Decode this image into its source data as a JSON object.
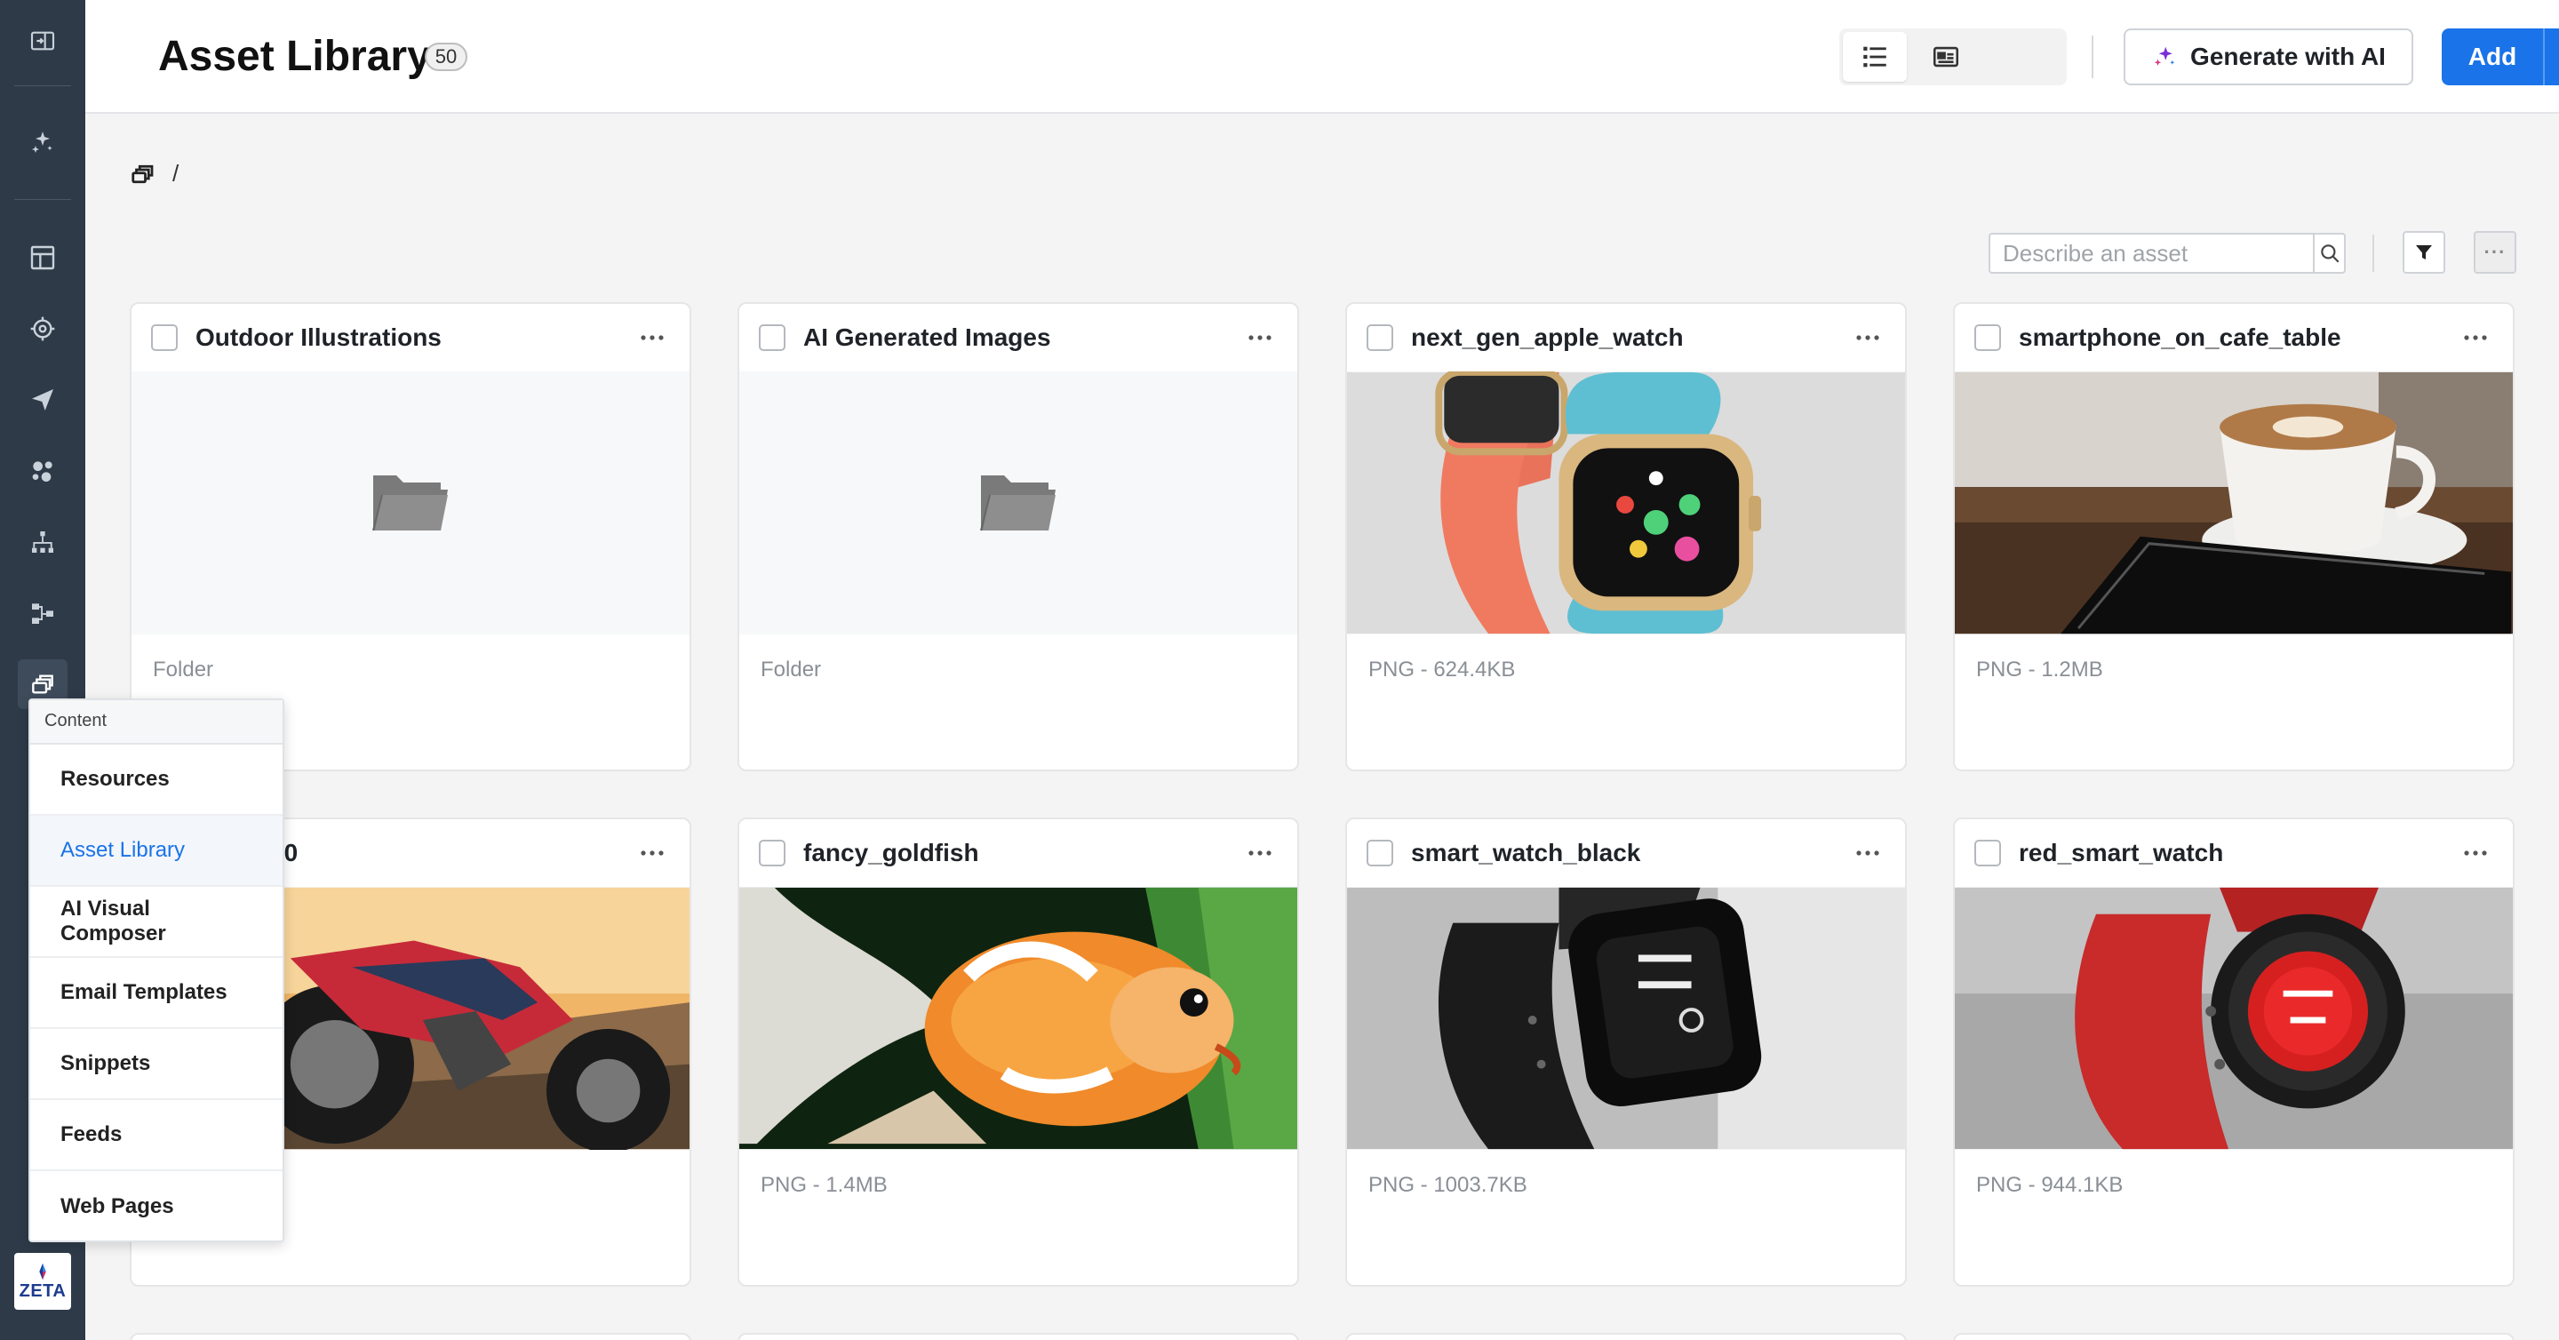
{
  "header": {
    "title": "Asset Library",
    "count": "50",
    "generate_label": "Generate with AI",
    "add_label": "Add"
  },
  "breadcrumb": {
    "separator": "/"
  },
  "search": {
    "placeholder": "Describe an asset"
  },
  "toolbar": {
    "more_label": "···"
  },
  "assets": [
    {
      "name": "Outdoor Illustrations",
      "meta": "Folder",
      "kind": "folder"
    },
    {
      "name": "AI Generated Images",
      "meta": "Folder",
      "kind": "folder"
    },
    {
      "name": "next_gen_apple_watch",
      "meta": "PNG - 624.4KB",
      "kind": "image"
    },
    {
      "name": "smartphone_on_cafe_table",
      "meta": "PNG - 1.2MB",
      "kind": "image"
    },
    {
      "name": "ki_z1000",
      "meta": "",
      "kind": "image"
    },
    {
      "name": "fancy_goldfish",
      "meta": "PNG - 1.4MB",
      "kind": "image"
    },
    {
      "name": "smart_watch_black",
      "meta": "PNG - 1003.7KB",
      "kind": "image"
    },
    {
      "name": "red_smart_watch",
      "meta": "PNG - 944.1KB",
      "kind": "image"
    }
  ],
  "flyout": {
    "title": "Content",
    "items": [
      "Resources",
      "Asset Library",
      "AI Visual Composer",
      "Email Templates",
      "Snippets",
      "Feeds",
      "Web Pages"
    ],
    "active": "Asset Library"
  },
  "brand": {
    "logo_text": "ZETA"
  },
  "colors": {
    "accent": "#1a73e8",
    "rail": "#2e3a48"
  }
}
